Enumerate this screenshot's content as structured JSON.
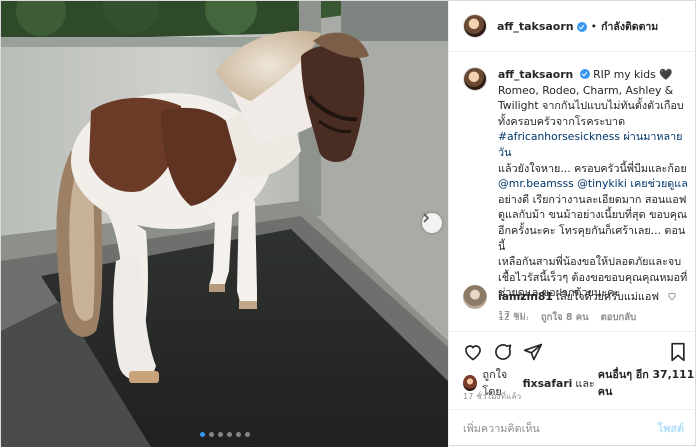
{
  "post": {
    "username": "aff_taksaorn",
    "separator": "•",
    "follow_status": "กำลังติดตาม",
    "caption_username": "aff_taksaorn",
    "caption_lines": [
      "RIP my kids 🖤",
      "Romeo, Rodeo, Charm, Ashley &",
      "Twilight จากกันไปแบบไม่ทันตั้งตัวเกือบ",
      "ทั้งครอบครัวจากโรคระบาด",
      "#africanhorsesickness ผ่านมาหลายวัน",
      "แล้วยังใจหาย... ครอบครัวนี้พี่บีมและก้อย",
      "@mr.beamsss @tinykiki เคยช่วยดูแล",
      "อย่างดี เรียกว่างานละเอียดมาก สอนแอฟ",
      "ดูแลกับม้า ขนม้าอย่างเนี้ยบที่สุด ขอบคุณ",
      "อีกครั้งนะคะ โทรคุยกันก็เศร้าเลย... ตอนนี้",
      "เหลือกันสามพี่น้องขอให้ปลอดภัยและจบ",
      "เชื้อไวรัสนี้เร็วๆ ต้องขอขอบคุณคุณหมอที่",
      "ช่วยดูแล ขอฝากด้วยนะคะ"
    ],
    "caption_time": "17 ชม."
  },
  "comment": {
    "username": "iamzin81",
    "text": "เสียใจด้วยครับแม่แอฟ",
    "time": "12 ชม.",
    "likes": "ถูกใจ 8 คน",
    "reply": "ตอบกลับ"
  },
  "likes": {
    "prefix": "ถูกใจโดย",
    "first_user": "fixsafari",
    "and": "และ",
    "others": "คนอื่นๆ อีก 37,111 คน"
  },
  "post_time": "17 ชั่วโมงที่แล้ว",
  "add_comment": {
    "placeholder": "เพิ่มความคิดเห็น",
    "post_label": "โพสต์"
  },
  "carousel": {
    "count": 6,
    "active": 0
  },
  "colors": {
    "link": "#003569",
    "verified": "#3897f0",
    "meta": "#8e8e8e"
  },
  "icons": {
    "like": "heart-icon",
    "comment": "comment-icon",
    "share": "share-icon",
    "save": "bookmark-icon",
    "next": "chevron-right-icon"
  }
}
